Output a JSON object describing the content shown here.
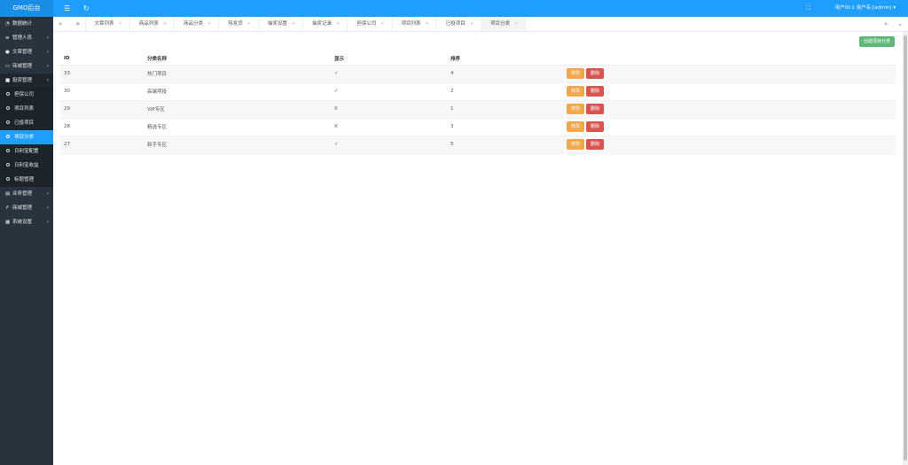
{
  "app": {
    "logo": "GMO后台",
    "user": "用户ID:1 用户名:[admin] ▾"
  },
  "sidebar": {
    "items": [
      {
        "label": "数据统计",
        "icon": "dashboard-icon",
        "has_arrow": false
      },
      {
        "label": "管理人员",
        "icon": "list-icon",
        "has_arrow": true
      },
      {
        "label": "文章管理",
        "icon": "palette-icon",
        "has_arrow": true
      },
      {
        "label": "商城管理",
        "icon": "monitor-icon",
        "has_arrow": true
      },
      {
        "label": "投资管理",
        "icon": "folder-icon",
        "has_arrow": true,
        "open": true
      }
    ],
    "sub_items": [
      {
        "label": "担保公司"
      },
      {
        "label": "项目列表"
      },
      {
        "label": "已投项目"
      },
      {
        "label": "项目分类",
        "active": true
      },
      {
        "label": "日利宝配置"
      },
      {
        "label": "日利宝收益"
      },
      {
        "label": "标题管理"
      }
    ],
    "items_after": [
      {
        "label": "业务管理",
        "icon": "table-icon"
      },
      {
        "label": "商城管理",
        "icon": "share-icon"
      },
      {
        "label": "系统设置",
        "icon": "grid-icon"
      }
    ]
  },
  "tabs": [
    {
      "label": "文章列表"
    },
    {
      "label": "商品列表"
    },
    {
      "label": "商品分类"
    },
    {
      "label": "待发货"
    },
    {
      "label": "抽奖设置"
    },
    {
      "label": "抽奖记录"
    },
    {
      "label": "担保公司"
    },
    {
      "label": "项目列表"
    },
    {
      "label": "已投项目"
    },
    {
      "label": "项目分类",
      "active": true
    }
  ],
  "toolbar": {
    "create_label": "创建项目分类"
  },
  "table": {
    "headers": [
      "ID",
      "分类名称",
      "显示",
      "排序",
      ""
    ],
    "edit_label": "修改",
    "delete_label": "删除",
    "rows": [
      {
        "id": "33",
        "name": "热门项目",
        "show": "✓",
        "sort": "4"
      },
      {
        "id": "30",
        "name": "高端项投",
        "show": "✓",
        "sort": "2"
      },
      {
        "id": "29",
        "name": "VIP专区",
        "show": "X",
        "sort": "1"
      },
      {
        "id": "28",
        "name": "精选专区",
        "show": "X",
        "sort": "3"
      },
      {
        "id": "27",
        "name": "新手专区",
        "show": "✓",
        "sort": "5"
      }
    ]
  },
  "colors": {
    "primary": "#1e9fff",
    "sidebar": "#28333e",
    "create": "#5fb878",
    "edit": "#f0a84a",
    "delete": "#d9534f"
  }
}
